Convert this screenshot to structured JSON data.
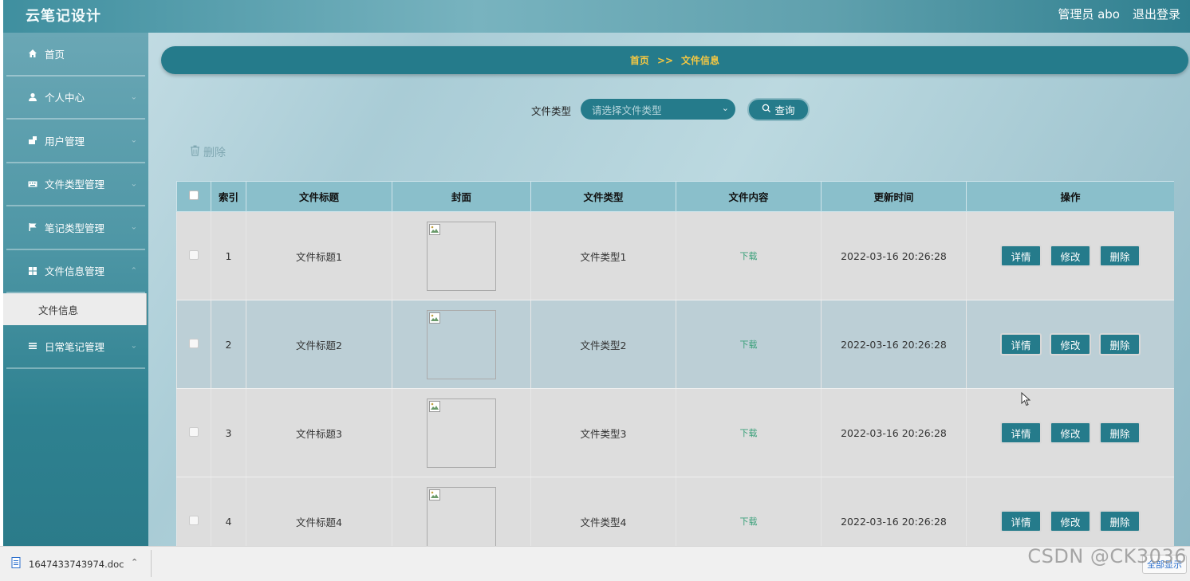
{
  "header": {
    "app_title": "云笔记设计",
    "admin": "管理员 abo",
    "logout": "退出登录"
  },
  "sidebar": {
    "items": [
      {
        "label": "首页",
        "icon": "home-icon"
      },
      {
        "label": "个人中心",
        "icon": "user-icon"
      },
      {
        "label": "用户管理",
        "icon": "user-manage-icon"
      },
      {
        "label": "文件类型管理",
        "icon": "keyboard-icon"
      },
      {
        "label": "笔记类型管理",
        "icon": "flag-icon"
      },
      {
        "label": "文件信息管理",
        "icon": "grid-icon"
      },
      {
        "label": "日常笔记管理",
        "icon": "list-icon"
      }
    ],
    "submenu_active": "文件信息"
  },
  "breadcrumb": {
    "home": "首页",
    "separator": ">>",
    "current": "文件信息"
  },
  "filter": {
    "label": "文件类型",
    "placeholder": "请选择文件类型",
    "query_button": "查询"
  },
  "delete_link": "删除",
  "table": {
    "headers": [
      "索引",
      "文件标题",
      "封面",
      "文件类型",
      "文件内容",
      "更新时间",
      "操作"
    ],
    "rows": [
      {
        "index": "1",
        "title": "文件标题1",
        "type": "文件类型1",
        "content": "下载",
        "time": "2022-03-16 20:26:28"
      },
      {
        "index": "2",
        "title": "文件标题2",
        "type": "文件类型2",
        "content": "下载",
        "time": "2022-03-16 20:26:28"
      },
      {
        "index": "3",
        "title": "文件标题3",
        "type": "文件类型3",
        "content": "下载",
        "time": "2022-03-16 20:26:28"
      },
      {
        "index": "4",
        "title": "文件标题4",
        "type": "文件类型4",
        "content": "下载",
        "time": "2022-03-16 20:26:28"
      }
    ],
    "actions": {
      "detail": "详情",
      "edit": "修改",
      "delete": "删除"
    }
  },
  "download_bar": {
    "filename": "1647433743974.doc",
    "show_all": "全部显示"
  },
  "watermark": "CSDN @CK3036",
  "colors": {
    "accent": "#257b8b",
    "breadcrumb_text": "#f5c842",
    "download_link": "#3aa07a"
  }
}
